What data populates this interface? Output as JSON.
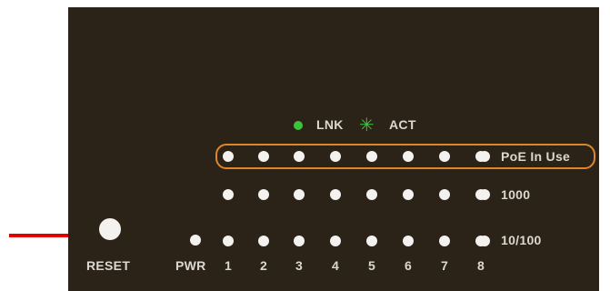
{
  "legend": {
    "lnk_label": "LNK",
    "act_label": "ACT",
    "lnk_led_color": "#3bc43b",
    "act_icon": "green-star-icon"
  },
  "rows": {
    "poe_label": "PoE In Use",
    "gig_label": "1000",
    "fast_label": "10/100"
  },
  "ports": [
    "1",
    "2",
    "3",
    "4",
    "5",
    "6",
    "7",
    "8"
  ],
  "pwr_label": "PWR",
  "reset_label": "RESET",
  "colors": {
    "panel": "#2b2218",
    "highlight": "#e0862a",
    "arrow": "#e00000",
    "led": "#f4f2ee"
  }
}
